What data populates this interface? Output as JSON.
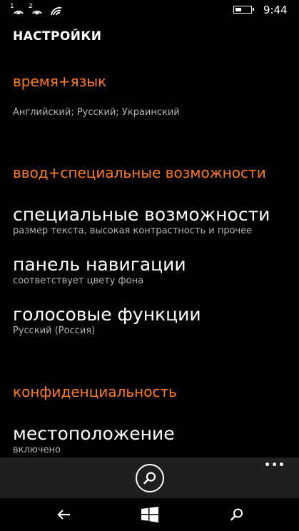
{
  "status_bar": {
    "sim1_label": "1",
    "sim2_label": "2",
    "time": "9:44"
  },
  "page_title": "НАСТРОЙКИ",
  "sections": {
    "time_language": {
      "header": "время+язык",
      "languages": "Английский; Русский; Украинский"
    },
    "input_accessibility": {
      "header": "ввод+специальные возможности",
      "items": [
        {
          "title": "специальные возможности",
          "subtitle": "размер текста, высокая контрастность и прочее"
        },
        {
          "title": "панель навигации",
          "subtitle": "соответствует цвету фона"
        },
        {
          "title": "голосовые функции",
          "subtitle": "Русский (Россия)"
        }
      ]
    },
    "privacy": {
      "header": "конфиденциальность",
      "items": [
        {
          "title": "местоположение",
          "subtitle": "включено"
        }
      ]
    }
  },
  "app_bar": {
    "more_label": "•••"
  },
  "colors": {
    "accent": "#ff7a1a",
    "background": "#000000",
    "app_bar": "#1f1f1f",
    "subtext": "#b3b3b3"
  },
  "icons": {
    "status": [
      "sim1-signal-icon",
      "sim2-signal-icon",
      "wifi-icon",
      "battery-icon"
    ],
    "app_bar": [
      "search-icon",
      "more-icon"
    ],
    "nav": [
      "back-icon",
      "windows-start-icon",
      "nav-search-icon"
    ]
  }
}
